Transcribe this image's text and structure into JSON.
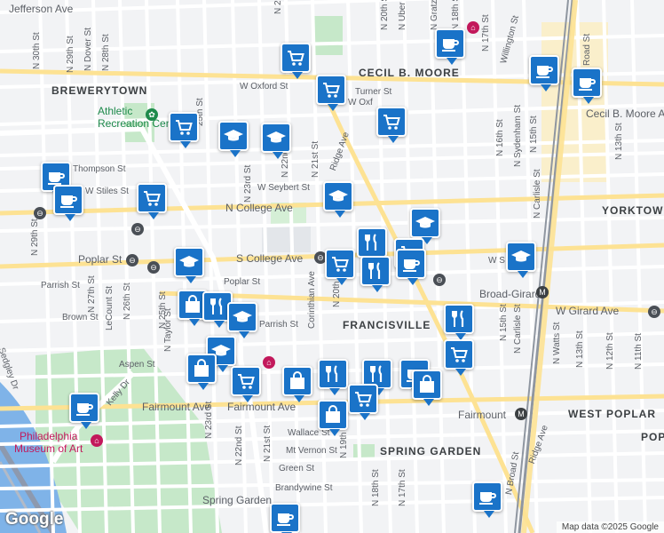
{
  "attribution": "Map data ©2025 Google",
  "brand": "Google",
  "neighborhoods": [
    "BREWERYTOWN",
    "CECIL B. MOORE",
    "YORKTOWN",
    "FRANCISVILLE",
    "SPRING GARDEN",
    "WEST POPLAR",
    "POP"
  ],
  "poi": {
    "park": "Athletic\nRecreation Center",
    "museum": "Philadelphia\nMuseum of Art"
  },
  "streets": {
    "jefferson": "Jefferson Ave",
    "oxford": "W Oxford St",
    "oxford2": "W Oxf",
    "turner": "Turner St",
    "thompson": "Thompson St",
    "stiles": "W Stiles St",
    "seybert": "W Seybert St",
    "college": "N College Ave",
    "poplar": "Poplar St",
    "scollege": "S College Ave",
    "parrish": "Parrish St",
    "poplar2": "Poplar St",
    "parrish2": "Parrish St",
    "brown": "Brown St",
    "aspen": "Aspen St",
    "fairmount": "Fairmount Ave",
    "fairmount2": "Fairmount Ave",
    "wallace": "Wallace St",
    "mtvernon": "Mt Vernon St",
    "green": "Green St",
    "brandywine": "Brandywine St",
    "springgarden": "Spring Garden",
    "wgirard": "W Girard Ave",
    "cecilmoore": "Cecil B. Moore Ave",
    "broadgirard": "Broad-Girard",
    "fairmountstation": "Fairmount",
    "n30": "N 30th St",
    "n29": "N 29th St",
    "ndover": "N Dover St",
    "n28": "N 28th St",
    "n29b": "N 29th St",
    "n27": "N 27th St",
    "lecount": "LeCount St",
    "n26": "N 26th St",
    "n25": "N 25th St",
    "n25b": "25th St",
    "ntaylor": "N Taylor St",
    "n23": "N 23rd St",
    "n22": "N 22nd St",
    "n23b": "N 23rd St",
    "n22b": "N 22nd St",
    "n21": "N 21st St",
    "n21b": "N 21st St",
    "corinthian": "Corinthian Ave",
    "n20": "N 20th",
    "n19": "N 19th St",
    "n18": "N 18th St",
    "n17": "N 17th St",
    "ridge": "Ridge Ave",
    "ridge2": "Ridge Ave",
    "sedgley": "Sedgley Dr",
    "kelly": "Kelly Dr",
    "n20top": "N 20th St",
    "uber": "N Uber St",
    "gratz": "N Gratz St",
    "n18top": "N 18th St",
    "n17top": "N 17th St",
    "willington": "Willington St",
    "n16": "N 16th St",
    "sydenham": "N Sydenham St",
    "n15": "N 15th St",
    "n15b": "N 15th St",
    "carlisle": "N Carlisle St",
    "carlisle2": "N Carlisle St",
    "nwatts": "N Watts St",
    "n13": "N 13th St",
    "n12": "N 12th St",
    "n11": "N 11th St",
    "n13top": "N 13th St",
    "broadroad": "Road St",
    "nbroad": "N Broad St",
    "wst": "W S",
    "n2top": "N 2"
  },
  "colors": {
    "pin": "#1a73c8",
    "road": "#ffffff",
    "arterial": "#fde293",
    "water": "#7fb3e8",
    "park": "#c6e8c9",
    "rail": "#8d99ae"
  }
}
